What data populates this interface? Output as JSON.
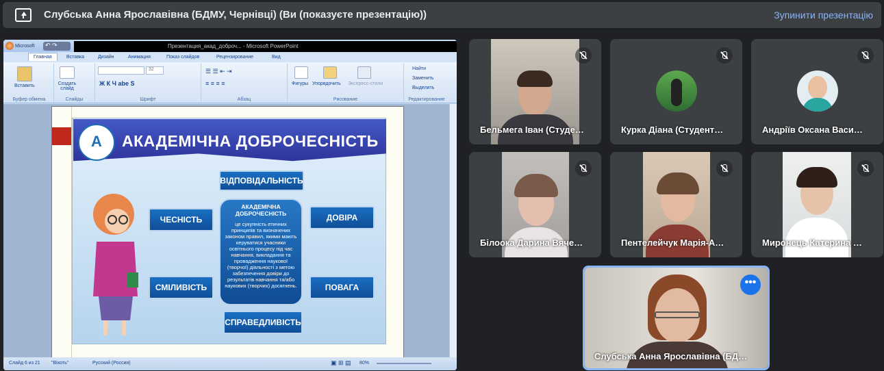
{
  "banner": {
    "title": "Слубська Анна Ярославівна (БДМУ, Чернівці) (Ви (показуєте презентацію))",
    "stop_label": "Зупинити презентацію"
  },
  "ppt": {
    "office_short": "Microsoft",
    "window_title": "Презентация_акад_доброч... - Microsoft PowerPoint",
    "tabs": [
      "Главная",
      "Вставка",
      "Дизайн",
      "Анимация",
      "Показ слайдов",
      "Рецензирование",
      "Вид"
    ],
    "groups": [
      "Буфер обмена",
      "Слайды",
      "Шрифт",
      "Абзац",
      "Рисование",
      "Редактирование"
    ],
    "buttons": {
      "paste": "Вставить",
      "new_slide": "Создать слайд",
      "shapes": "Фигуры",
      "arrange": "Упорядочить",
      "quick_styles": "Экспресс-стили",
      "find": "Найти",
      "replace": "Заменить",
      "select": "Выделить"
    },
    "font_size": "32",
    "status": {
      "slide": "Слайд 6 из 21",
      "theme": "\"Віхоть\"",
      "lang": "Русский (Россия)",
      "zoom": "80%"
    }
  },
  "slide": {
    "logo_text": "A",
    "title": "АКАДЕМІЧНА ДОБРОЧЕСНІСТЬ",
    "center_heading": "АКАДЕМІЧНА ДОБРОЧЕСНІСТЬ",
    "center_body": "це сукупність етичних принципів та визначених законом правил, якими мають керуватися учасники освітнього процесу під час навчання, викладання та провадження наукової (творчої) діяльності з метою забезпечення довіри до результатів навчання та/або наукових (творчих) досягнень.",
    "values": {
      "top": "ВІДПОВІДАЛЬНІСТЬ",
      "left": "ЧЕСНІСТЬ",
      "right": "ДОВІРА",
      "bottom_left": "СМІЛИВІСТЬ",
      "bottom_right": "ПОВАГА",
      "bottom": "СПРАВЕДЛИВІСТЬ"
    }
  },
  "participants": [
    {
      "name": "Бельмега Іван (Студе…"
    },
    {
      "name": "Курка Діана (Студент…"
    },
    {
      "name": "Андріїв Оксана Васи…"
    },
    {
      "name": "Білоока Дарина Вяче…"
    },
    {
      "name": "Пентелейчук Марія-А…"
    },
    {
      "name": "Миронець Катерина …"
    },
    {
      "name": "Слубська Анна Ярославівна (БД…"
    }
  ],
  "colors": {
    "meet_bg": "#202124",
    "tile_bg": "#3c4043",
    "accent": "#8ab4f8",
    "slide_blue": "#1a6fc2"
  }
}
